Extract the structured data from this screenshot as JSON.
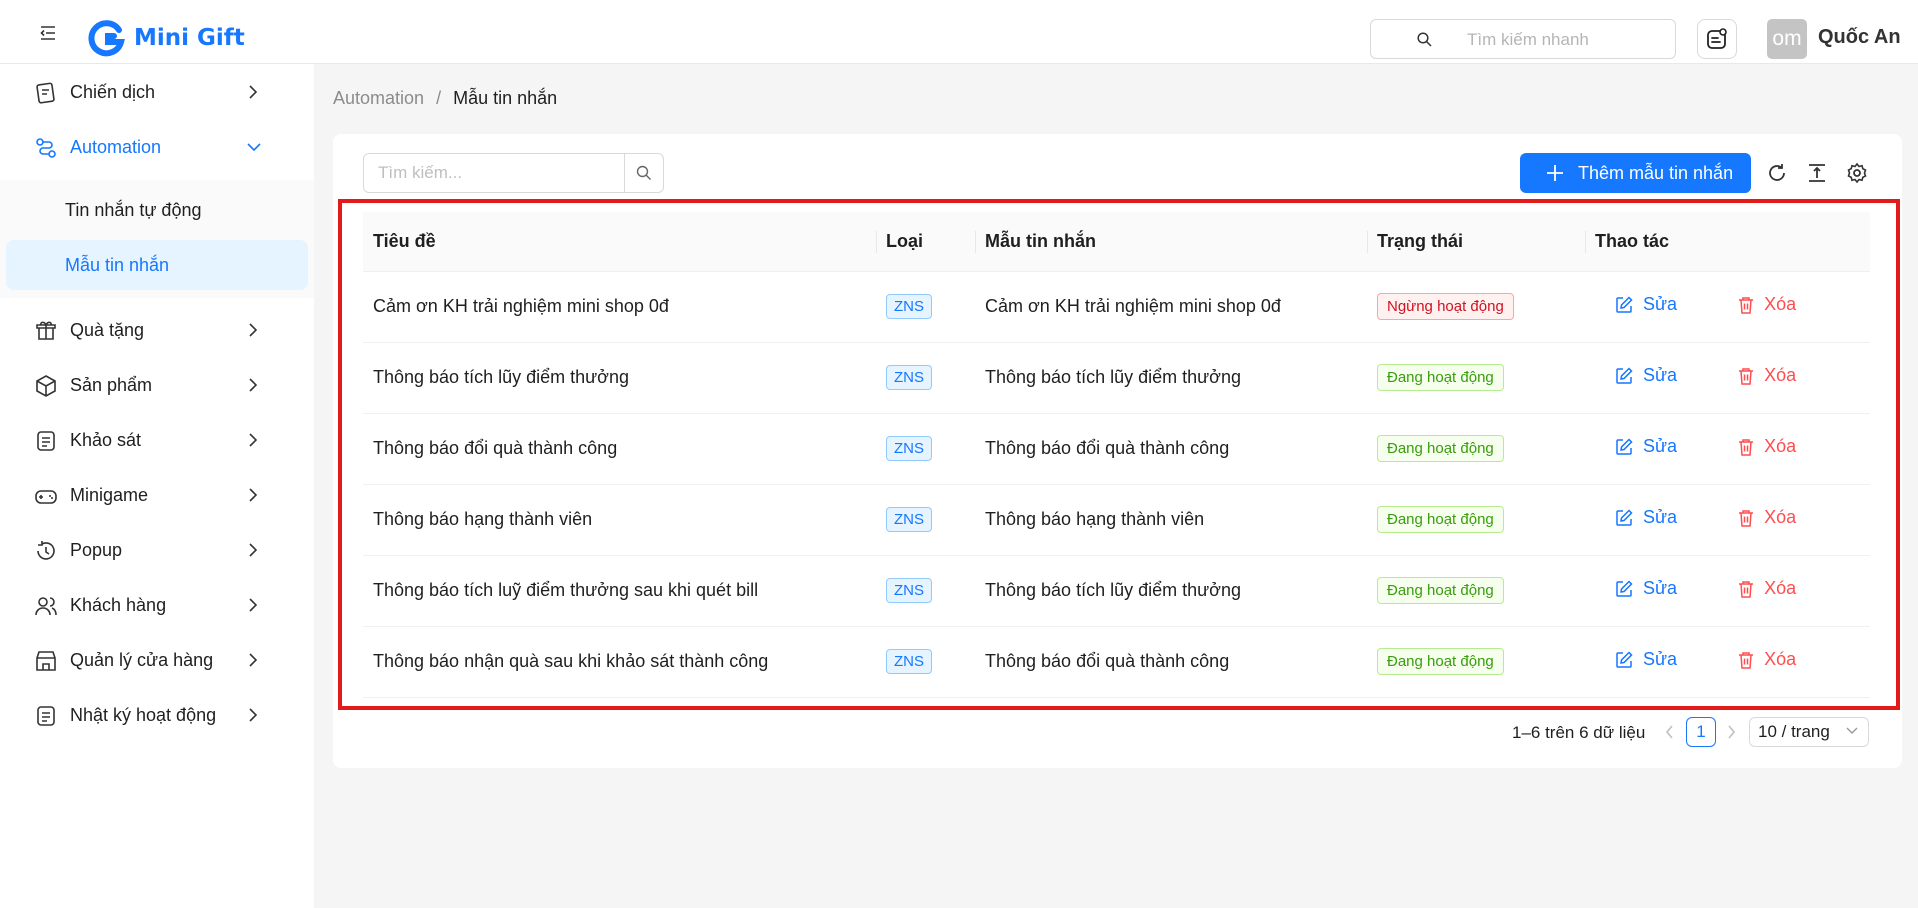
{
  "header": {
    "app_name": "Mini Gift",
    "search_placeholder": "Tìm kiếm nhanh",
    "avatar_text": "om",
    "user_name": "Quốc An"
  },
  "sidebar": {
    "items": [
      {
        "label": "Chiến dịch",
        "icon": "campaign-icon"
      },
      {
        "label": "Automation",
        "icon": "automation-icon"
      },
      {
        "label": "Quà tặng",
        "icon": "gift-icon"
      },
      {
        "label": "Sản phẩm",
        "icon": "box-icon"
      },
      {
        "label": "Khảo sát",
        "icon": "survey-icon"
      },
      {
        "label": "Minigame",
        "icon": "game-icon"
      },
      {
        "label": "Popup",
        "icon": "popup-icon"
      },
      {
        "label": "Khách hàng",
        "icon": "users-icon"
      },
      {
        "label": "Quản lý cửa hàng",
        "icon": "store-icon"
      },
      {
        "label": "Nhật ký hoạt động",
        "icon": "log-icon"
      }
    ],
    "sub_items": [
      {
        "label": "Tin nhắn tự động"
      },
      {
        "label": "Mẫu tin nhắn"
      }
    ]
  },
  "breadcrumb": {
    "parent": "Automation",
    "separator": "/",
    "current": "Mẫu tin nhắn"
  },
  "toolbar": {
    "search_placeholder": "Tìm kiếm...",
    "add_label": "Thêm mẫu tin nhắn"
  },
  "table": {
    "columns": [
      "Tiêu đề",
      "Loại",
      "Mẫu tin nhắn",
      "Trạng thái",
      "Thao tác"
    ],
    "edit_label": "Sửa",
    "delete_label": "Xóa",
    "rows": [
      {
        "title": "Cảm ơn KH trải nghiệm mini shop 0đ",
        "type": "ZNS",
        "template": "Cảm ơn KH trải nghiệm mini shop 0đ",
        "status": "Ngừng hoạt động"
      },
      {
        "title": "Thông báo tích lũy điểm thưởng",
        "type": "ZNS",
        "template": "Thông báo tích lũy điểm thưởng",
        "status": "Đang hoạt động"
      },
      {
        "title": "Thông báo đổi quà thành công",
        "type": "ZNS",
        "template": "Thông báo đổi quà thành công",
        "status": "Đang hoạt động"
      },
      {
        "title": "Thông báo hạng thành viên",
        "type": "ZNS",
        "template": "Thông báo hạng thành viên",
        "status": "Đang hoạt động"
      },
      {
        "title": "Thông báo tích luỹ điểm thưởng sau khi quét bill",
        "type": "ZNS",
        "template": "Thông báo tích lũy điểm thưởng",
        "status": "Đang hoạt động"
      },
      {
        "title": "Thông báo nhận quà sau khi khảo sát thành công",
        "type": "ZNS",
        "template": "Thông báo đổi quà thành công",
        "status": "Đang hoạt động"
      }
    ]
  },
  "pagination": {
    "summary": "1–6 trên 6 dữ liệu",
    "current_page": "1",
    "page_size": "10 / trang"
  },
  "colors": {
    "primary": "#1677ff",
    "danger": "#ff4d4f",
    "success": "#389e0d",
    "highlight": "#e21a1a"
  }
}
